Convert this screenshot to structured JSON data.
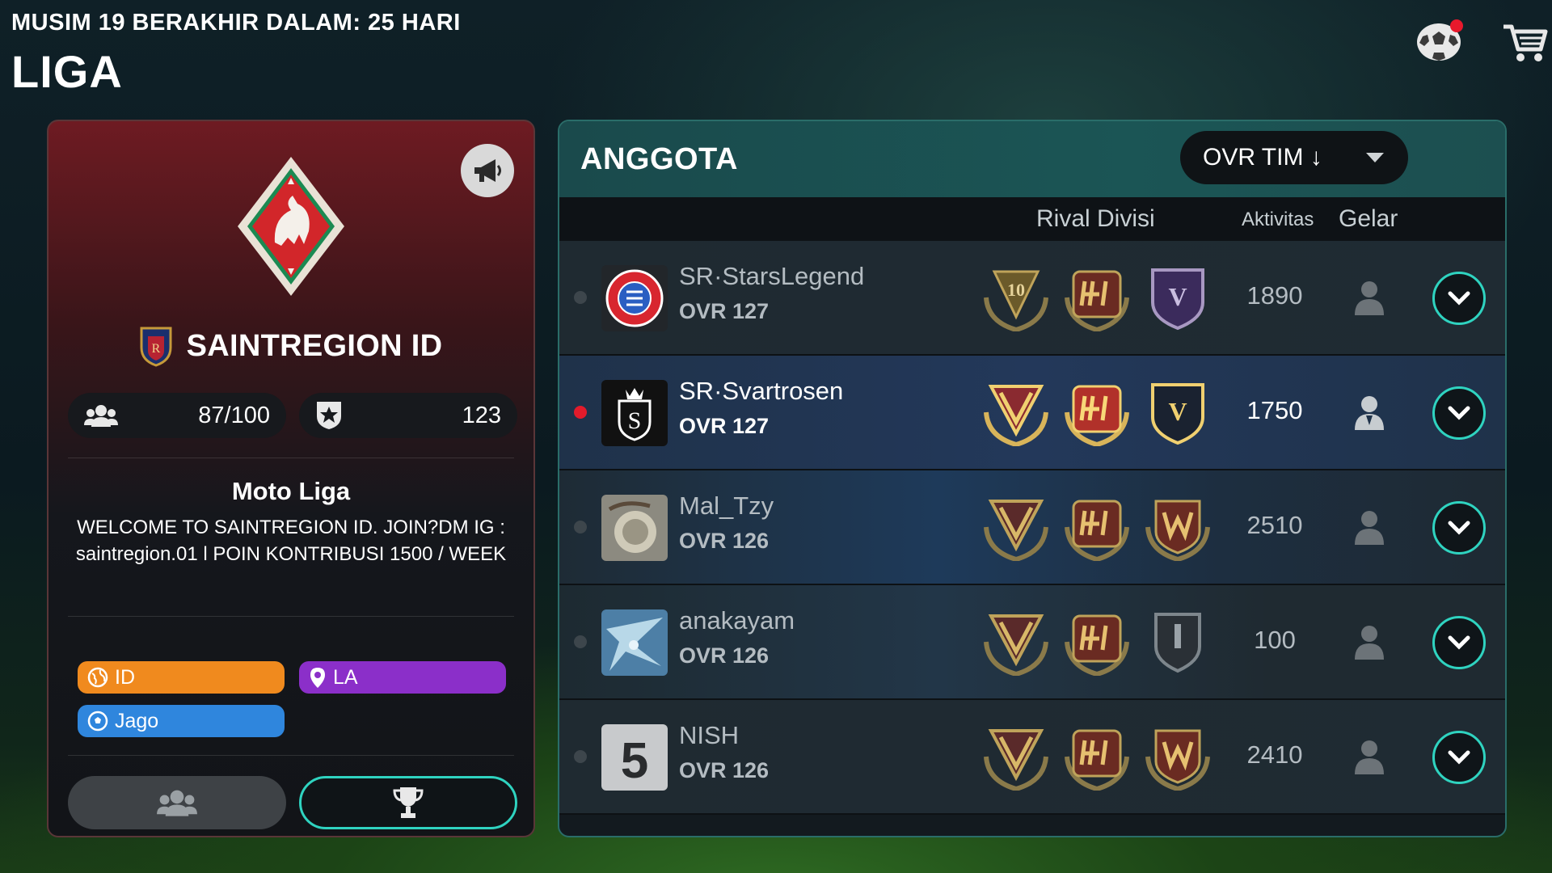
{
  "header": {
    "season_text": "MUSIM 19 BERAKHIR DALAM: 25 HARI",
    "title": "LIGA",
    "icons": [
      "soccer-ball-icon",
      "cart-icon"
    ]
  },
  "club": {
    "name": "SAINTREGION ID",
    "members_count": "87/100",
    "rating": "123",
    "league_name": "Moto Liga",
    "description": "WELCOME TO SAINTREGION ID. JOIN?DM IG : saintregion.01 l POIN KONTRIBUSI 1500 / WEEK",
    "tags": {
      "region": "ID",
      "location": "LA",
      "level": "Jago"
    },
    "colors": {
      "tag_region": "#f08a1e",
      "tag_location": "#8b2fc9",
      "tag_level": "#2f86dd",
      "accent": "#2fd3c0"
    }
  },
  "members": {
    "title": "ANGGOTA",
    "sort_label": "OVR TIM ↓",
    "columns": {
      "rival": "Rival Divisi",
      "activity": "Aktivitas",
      "title": "Gelar"
    },
    "rows": [
      {
        "name": "SR·StarsLegend",
        "ovr": "OVR 127",
        "activity": "1890",
        "online": false
      },
      {
        "name": "SR·Svartrosen",
        "ovr": "OVR 127",
        "activity": "1750",
        "online": true
      },
      {
        "name": "Mal_Tzy",
        "ovr": "OVR 126",
        "activity": "2510",
        "online": false
      },
      {
        "name": "anakayam",
        "ovr": "OVR 126",
        "activity": "100",
        "online": false
      },
      {
        "name": "NISH",
        "ovr": "OVR 126",
        "activity": "2410",
        "online": false
      }
    ]
  }
}
